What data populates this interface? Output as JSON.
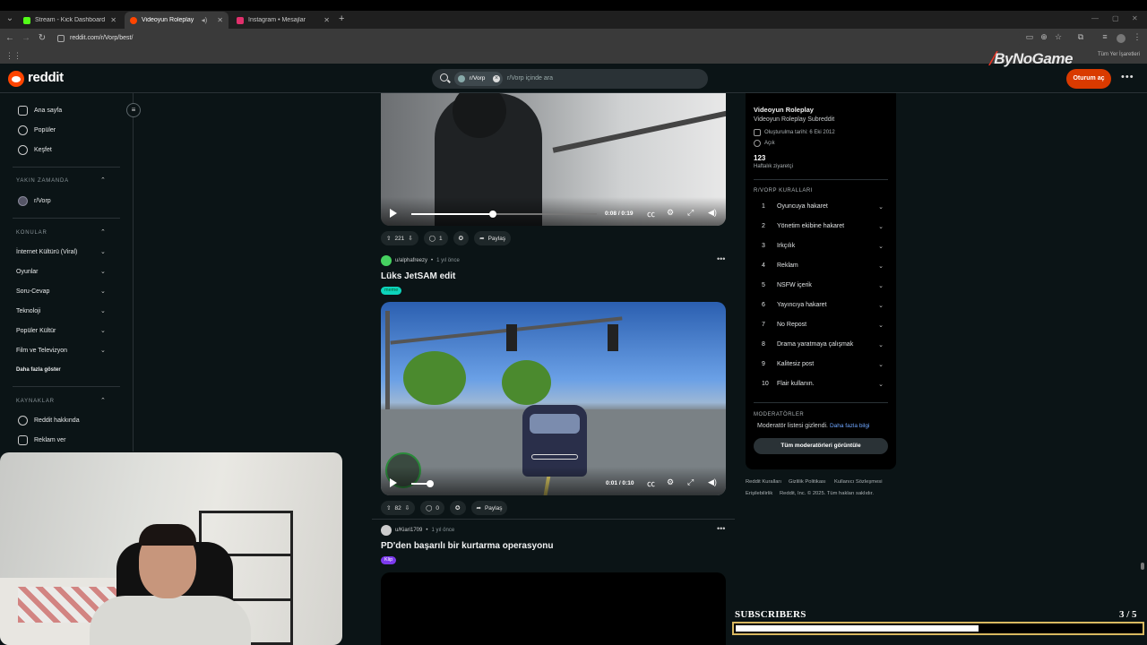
{
  "browser": {
    "tabs": [
      {
        "label": "Stream - Kick Dashboard",
        "color": "#53fc18"
      },
      {
        "label": "Videoyun Roleplay",
        "color": "#ff4500"
      },
      {
        "label": "Instagram • Mesajlar",
        "color": "#e1306c"
      }
    ],
    "url": "reddit.com/r/Vorp/best/",
    "all_bookmarks": "Tüm Yer İşaretleri"
  },
  "reddit": {
    "logo": "reddit",
    "search_chip": "r/Vorp",
    "search_placeholder": "r/Vorp içinde ara",
    "login": "Oturum aç",
    "watermark": "ByNoGame"
  },
  "sidebar": {
    "nav": [
      "Ana sayfa",
      "Popüler",
      "Keşfet"
    ],
    "recent_title": "YAKIN ZAMANDA",
    "recent_items": [
      "r/Vorp"
    ],
    "topics_title": "KONULAR",
    "topics": [
      "İnternet Kültürü (Viral)",
      "Oyunlar",
      "Soru-Cevap",
      "Teknoloji",
      "Popüler Kültür",
      "Film ve Televizyon"
    ],
    "show_more": "Daha fazla göster",
    "resources_title": "KAYNAKLAR",
    "resources": [
      "Reddit hakkında",
      "Reklam ver"
    ]
  },
  "feed": {
    "post1": {
      "time": "0:08 / 0:19",
      "progress": 0.44,
      "upvotes": "221",
      "comments": "1",
      "share": "Paylaş"
    },
    "post2": {
      "user": "u/alphafreezy",
      "age": "1 yıl önce",
      "title": "Lüks JetSAM edit",
      "flair": "meme",
      "flair_color": "#0dd3bb",
      "time": "0:01 / 0:10",
      "progress": 0.1,
      "upvotes": "82",
      "comments": "0",
      "share": "Paylaş"
    },
    "post3": {
      "user": "u/Kiari1709",
      "age": "1 yıl önce",
      "title": "PD'den başarılı bir kurtarma operasyonu",
      "flair": "Klip",
      "flair_color": "#7c3aed"
    }
  },
  "about": {
    "title": "Videoyun Roleplay",
    "subtitle": "Videoyun Roleplay Subreddit",
    "created": "Oluşturulma tarihi: 6 Eki 2012",
    "visibility": "Açık",
    "weekly_visitors": "123",
    "weekly_label": "Haftalık ziyaretçi",
    "rules_title": "R/VORP KURALLARI",
    "rules": [
      "Oyuncuya hakaret",
      "Yönetim ekibine hakaret",
      "Irkçılık",
      "Reklam",
      "NSFW içerik",
      "Yayıncıya hakaret",
      "No Repost",
      "Drama yaratmaya çalışmak",
      "Kalitesiz post",
      "Flair kullanın."
    ],
    "mods_title": "MODERATÖRLER",
    "mods_hidden": "Moderatör listesi gizlendi.",
    "mods_more": "Daha fazla bilgi",
    "mods_button": "Tüm moderatörleri görüntüle",
    "footer1": [
      "Reddit Kuralları",
      "Gizlilik Politikası",
      "Kullanıcı Sözleşmesi"
    ],
    "footer2": [
      "Erişilebilirlik",
      "Reddit, Inc. © 2025. Tüm hakları saklıdır."
    ]
  },
  "overlay": {
    "subs_label": "SUBSCRIBERS",
    "subs_count": "3  / 5",
    "subs_progress": 0.6
  }
}
